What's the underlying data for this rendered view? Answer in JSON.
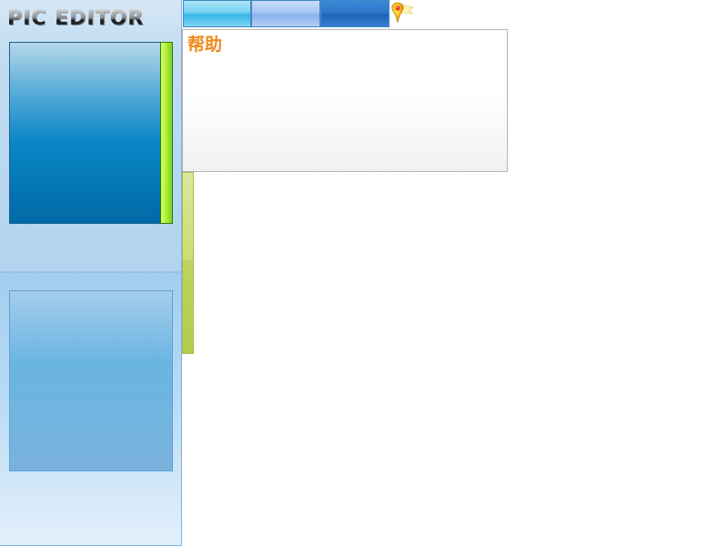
{
  "app": {
    "logo_text": "PIC EDITOR"
  },
  "toolbar": {
    "tabs": [
      {
        "label": ""
      },
      {
        "label": ""
      },
      {
        "label": ""
      }
    ],
    "pin_icon": "map-pin-icon"
  },
  "help_panel": {
    "title": "帮助"
  },
  "colors": {
    "accent_orange": "#f0891a",
    "preview_blue": "#0a86c4",
    "slider_green": "#b6f23e",
    "sidebar_blue": "#b2d3ee"
  }
}
